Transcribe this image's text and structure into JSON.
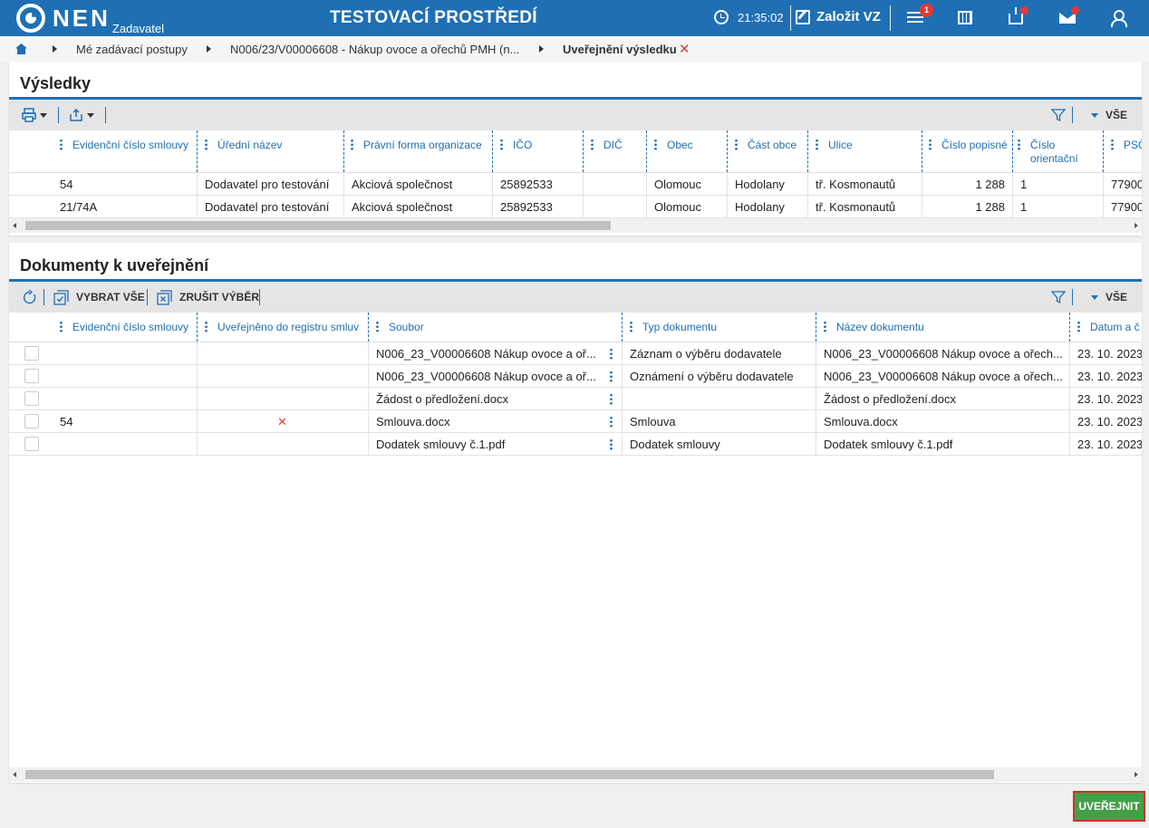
{
  "header": {
    "logo_text": "NEN",
    "logo_sub": "Zadavatel",
    "env_title": "TESTOVACÍ PROSTŘEDÍ",
    "clock": "21:35:02",
    "create_label": "Založit VZ",
    "notification_count": "1"
  },
  "breadcrumb": {
    "items": [
      "Mé zadávací postupy",
      "N006/23/V00006608 - Nákup ovoce a ořechů PMH (n..."
    ],
    "current": "Uveřejnění výsledku",
    "close": "✕"
  },
  "results": {
    "title": "Výsledky",
    "filter_all": "VŠE",
    "columns": [
      "Evidenční číslo smlouvy",
      "Úřední název",
      "Právní forma organizace",
      "IČO",
      "DIČ",
      "Obec",
      "Část obce",
      "Ulice",
      "Číslo popisné",
      "Číslo orientační",
      "PSČ"
    ],
    "rows": [
      [
        "54",
        "Dodavatel pro testování",
        "Akciová společnost",
        "25892533",
        "",
        "Olomouc",
        "Hodolany",
        "tř. Kosmonautů",
        "1 288",
        "1",
        "77900"
      ],
      [
        "21/74A",
        "Dodavatel pro testování",
        "Akciová společnost",
        "25892533",
        "",
        "Olomouc",
        "Hodolany",
        "tř. Kosmonautů",
        "1 288",
        "1",
        "77900"
      ]
    ]
  },
  "documents": {
    "title": "Dokumenty k uveřejnění",
    "select_all": "VYBRAT VŠE",
    "deselect": "ZRUŠIT VÝBĚR",
    "filter_all": "VŠE",
    "columns": [
      "Evidenční číslo smlouvy",
      "Uveřejněno do registru smluv",
      "Soubor",
      "Typ dokumentu",
      "Název dokumentu",
      "Datum a č"
    ],
    "rows": [
      {
        "contract": "",
        "registry": "",
        "file": "N006_23_V00006608 Nákup ovoce a oř...",
        "type": "Záznam o výběru dodavatele",
        "name": "N006_23_V00006608 Nákup ovoce a ořech...",
        "date": "23. 10. 2023"
      },
      {
        "contract": "",
        "registry": "",
        "file": "N006_23_V00006608 Nákup ovoce a oř...",
        "type": "Oznámení o výběru dodavatele",
        "name": "N006_23_V00006608 Nákup ovoce a ořech...",
        "date": "23. 10. 2023"
      },
      {
        "contract": "",
        "registry": "",
        "file": "Žádost o předložení.docx",
        "type": "",
        "name": "Žádost o předložení.docx",
        "date": "23. 10. 2023"
      },
      {
        "contract": "54",
        "registry": "✕",
        "file": "Smlouva.docx",
        "type": "Smlouva",
        "name": "Smlouva.docx",
        "date": "23. 10. 2023"
      },
      {
        "contract": "",
        "registry": "",
        "file": "Dodatek smlouvy č.1.pdf",
        "type": "Dodatek smlouvy",
        "name": "Dodatek smlouvy č.1.pdf",
        "date": "23. 10. 2023"
      }
    ]
  },
  "footer": {
    "publish_label": "UVEŘEJNIT"
  }
}
